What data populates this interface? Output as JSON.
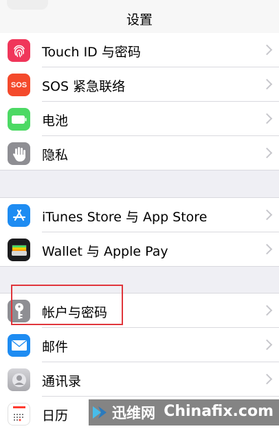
{
  "nav": {
    "title": "设置"
  },
  "groups": [
    {
      "rows": [
        {
          "label": "Touch ID 与密码",
          "icon": "fingerprint-icon",
          "color": "#f0365a"
        },
        {
          "label": "SOS 紧急联络",
          "icon": "sos-icon",
          "icon_text": "SOS",
          "color": "#f44a2c"
        },
        {
          "label": "电池",
          "icon": "battery-icon",
          "color": "#4cd964"
        },
        {
          "label": "隐私",
          "icon": "hand-icon",
          "color": "#8e8e93"
        }
      ]
    },
    {
      "rows": [
        {
          "label": "iTunes Store 与 App Store",
          "icon": "app-store-icon",
          "color": "#1e8cf2"
        },
        {
          "label": "Wallet 与 Apple Pay",
          "icon": "wallet-icon",
          "color": "#1c1c1e"
        }
      ]
    },
    {
      "rows": [
        {
          "label": "帐户与密码",
          "icon": "key-icon",
          "color": "#8e8e93"
        },
        {
          "label": "邮件",
          "icon": "mail-icon",
          "color": "#1e8cf2"
        },
        {
          "label": "通讯录",
          "icon": "contacts-icon",
          "color": "#b8b8bd"
        },
        {
          "label": "日历",
          "icon": "calendar-icon",
          "color": "#ffffff"
        }
      ]
    }
  ],
  "watermark": {
    "brand": "迅维网",
    "site": "Chinafix.com"
  },
  "colors": {
    "highlight": "#e0353b",
    "chevron": "#c7c7cc",
    "background": "#efeff4"
  }
}
